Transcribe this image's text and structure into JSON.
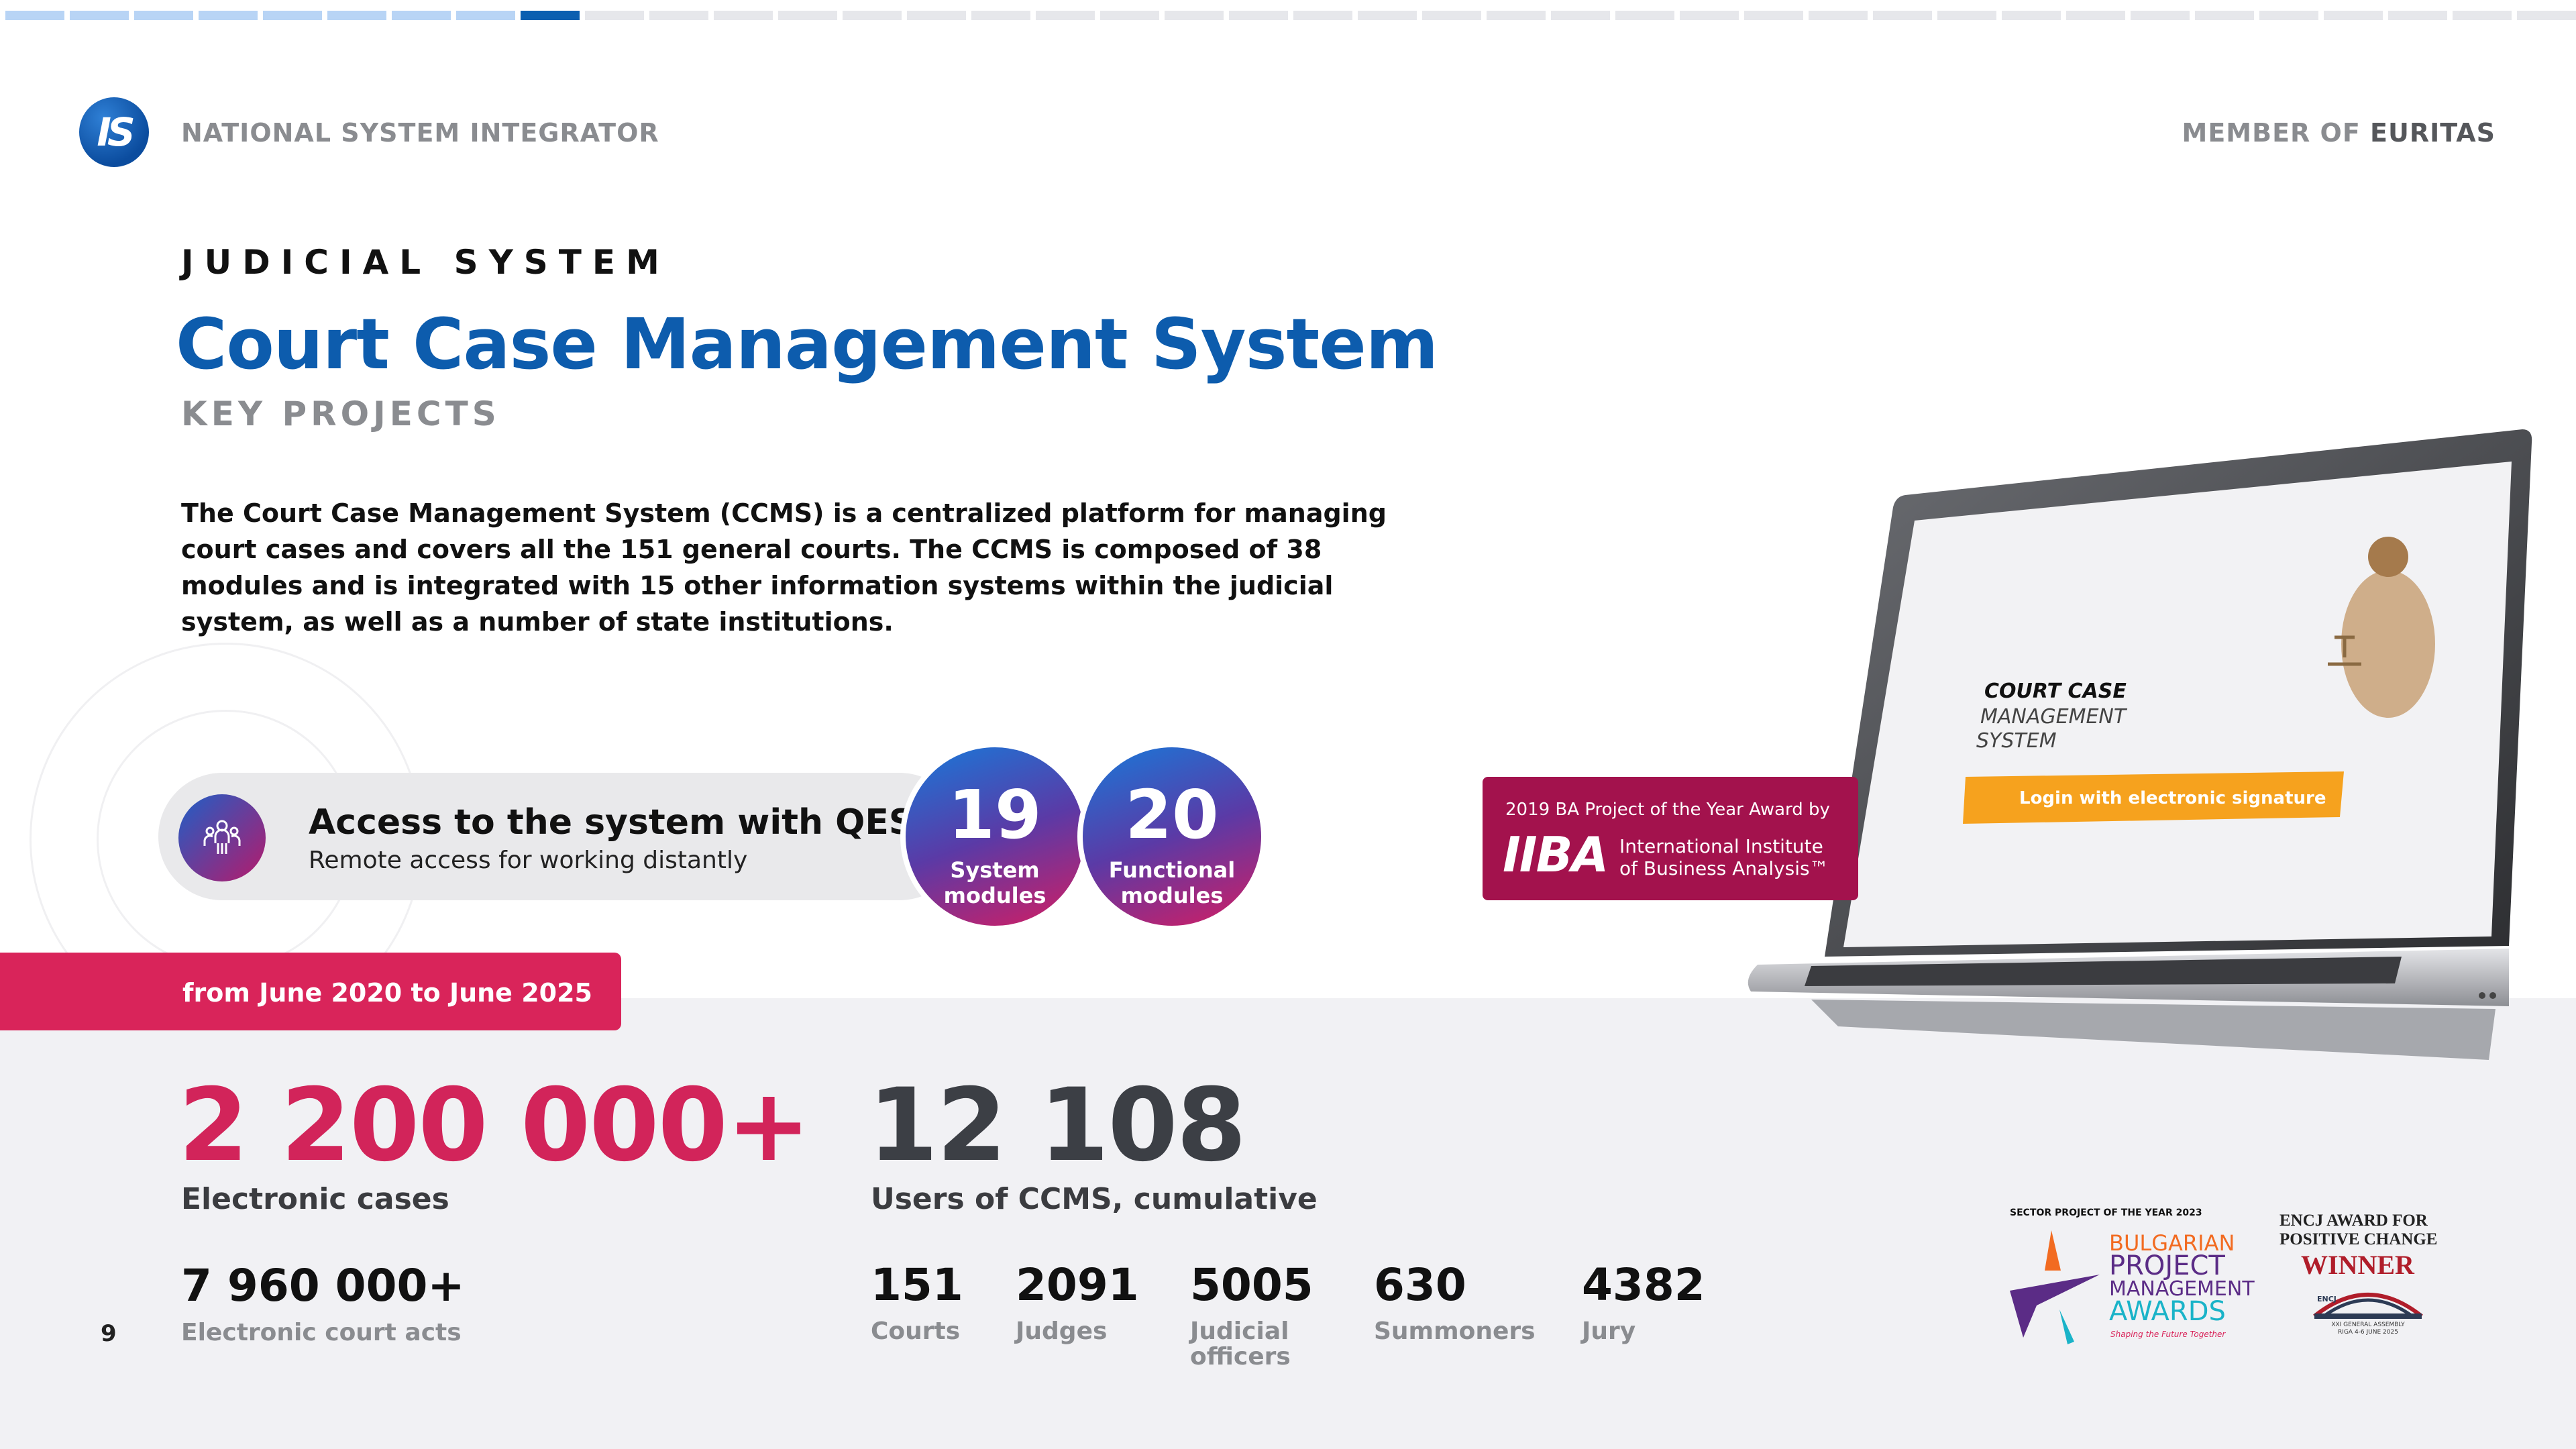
{
  "progress": {
    "total": 40,
    "completed": 8,
    "current": 9
  },
  "header": {
    "logo_text": "IS",
    "org": "NATIONAL SYSTEM INTEGRATOR",
    "member_prefix": "MEMBER OF",
    "member_name": "EURITAS"
  },
  "section": {
    "eyebrow": "JUDICIAL SYSTEM",
    "title": "Court Case Management System",
    "subtitle": "KEY PROJECTS",
    "description": "The Court Case Management System (CCMS) is a centralized platform for managing court cases and covers all the 151 general courts. The CCMS is composed of 38 modules and is integrated with 15 other information systems within the judicial system, as well as a number of state institutions."
  },
  "qes": {
    "icon": "people-network-icon",
    "title": "Access to the system with QES",
    "subtitle": "Remote  access for working distantly"
  },
  "modules": [
    {
      "value": "19",
      "label_1": "System",
      "label_2": "modules"
    },
    {
      "value": "20",
      "label_1": "Functional",
      "label_2": "modules"
    }
  ],
  "period": "from June 2020 to June 2025",
  "stats": {
    "cases_value": "2 200 000+",
    "cases_label": "Electronic cases",
    "users_value": "12 108",
    "users_label": "Users of CCMS, cumulative",
    "acts_value": "7 960 000+",
    "acts_label": "Electronic court acts",
    "breakdown": [
      {
        "value": "151",
        "label": "Courts"
      },
      {
        "value": "2091",
        "label": "Judges"
      },
      {
        "value": "5005",
        "label": "Judicial officers"
      },
      {
        "value": "630",
        "label": "Summoners"
      },
      {
        "value": "4382",
        "label": "Jury"
      }
    ]
  },
  "page_number": "9",
  "laptop_screen": {
    "title_1": "COURT CASE",
    "title_2": "MANAGEMENT",
    "title_3": "SYSTEM",
    "login_button": "Login with electronic signature"
  },
  "iiba_award": {
    "caption": "2019 BA Project of the Year Award by",
    "logo": "IIBA",
    "name_1": "International Institute",
    "name_2": "of Business Analysis™"
  },
  "awards": {
    "pm_caption": "SECTOR PROJECT OF THE YEAR 2023",
    "pm_1": "BULGARIAN",
    "pm_2": "PROJECT",
    "pm_3": "MANAGEMENT",
    "pm_4": "AWARDS",
    "pm_tag": "Shaping the Future Together",
    "encj_1": "ENCJ AWARD FOR",
    "encj_2": "POSITIVE CHANGE",
    "encj_3": "WINNER",
    "encj_logo": "ENCJ",
    "encj_event": "XXI GENERAL ASSEMBLY",
    "encj_place": "RIGA 4-6 JUNE 2025"
  },
  "colors": {
    "brand_blue": "#0d5cad",
    "accent_red": "#d2245a",
    "iiba_crimson": "#a3124d",
    "login_orange": "#f6a21e"
  }
}
